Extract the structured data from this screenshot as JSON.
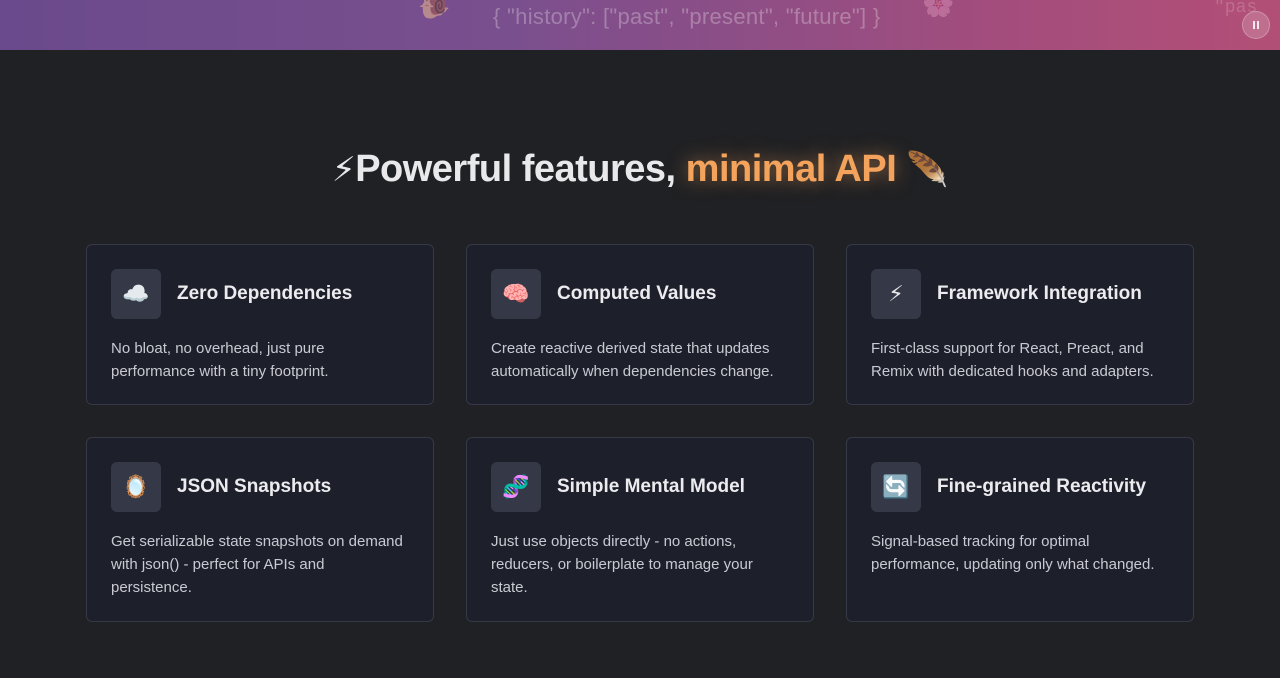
{
  "hero": {
    "code_text": "{ \"history\": [\"past\", \"present\", \"future\"] }",
    "code_text_right": "\"pas",
    "pause_label": "⏸",
    "deco_icons": [
      "snail-icon",
      "flower-icon"
    ]
  },
  "section": {
    "title_part1": "⚡",
    "title_part2": "Powerful features,",
    "title_highlight": "minimal API",
    "title_part3": "🪶"
  },
  "features": [
    {
      "icon": "☁️",
      "icon_name": "cloud-icon",
      "title": "Zero Dependencies",
      "description": "No bloat, no overhead, just pure performance with a tiny footprint."
    },
    {
      "icon": "🧠",
      "icon_name": "brain-icon",
      "title": "Computed Values",
      "description": "Create reactive derived state that updates automatically when dependencies change."
    },
    {
      "icon": "⚡",
      "icon_name": "lightning-icon",
      "title": "Framework Integration",
      "description": "First-class support for React, Preact, and Remix with dedicated hooks and adapters."
    },
    {
      "icon": "🪞",
      "icon_name": "mirror-icon",
      "title": "JSON Snapshots",
      "description": "Get serializable state snapshots on demand with json() - perfect for APIs and persistence."
    },
    {
      "icon": "🧬",
      "icon_name": "dna-icon",
      "title": "Simple Mental Model",
      "description": "Just use objects directly - no actions, reducers, or boilerplate to manage your state."
    },
    {
      "icon": "🔄",
      "icon_name": "refresh-icon",
      "title": "Fine-grained Reactivity",
      "description": "Signal-based tracking for optimal performance, updating only what changed."
    }
  ],
  "colors": {
    "background": "#202124",
    "card_bg": "#1d1f2b",
    "card_border": "#353846",
    "accent": "#f3a35c"
  }
}
